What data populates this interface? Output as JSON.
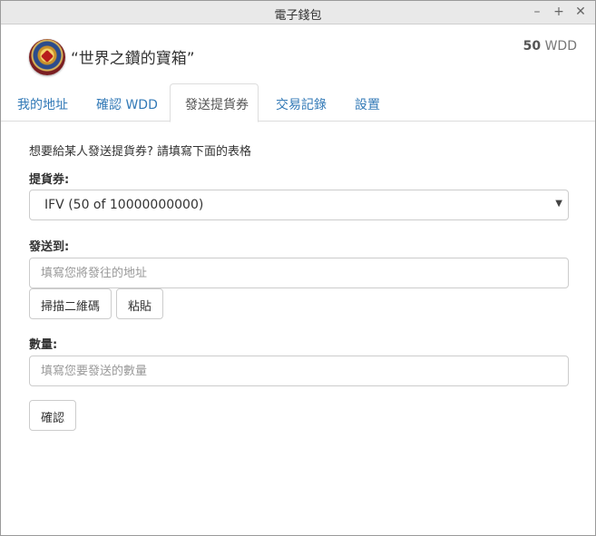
{
  "window": {
    "title": "電子錢包",
    "controls": {
      "minimize": "–",
      "maximize": "+",
      "close": "✕"
    }
  },
  "header": {
    "wallet_name": "“世界之鑽的寶箱”",
    "balance_amount": "50",
    "balance_unit": "WDD"
  },
  "tabs": [
    {
      "label": "我的地址",
      "active": false
    },
    {
      "label": "確認 WDD",
      "active": false
    },
    {
      "label": "發送提貨券",
      "active": true
    },
    {
      "label": "交易記錄",
      "active": false
    },
    {
      "label": "設置",
      "active": false
    }
  ],
  "form": {
    "intro": "想要給某人發送提貨券? 請填寫下面的表格",
    "voucher_label": "提貨券:",
    "voucher_selected": "IFV (50 of 10000000000)",
    "send_to_label": "發送到:",
    "address_placeholder": "填寫您將發往的地址",
    "scan_button": "掃描二維碼",
    "paste_button": "粘貼",
    "amount_label": "數量:",
    "amount_placeholder": "填寫您要發送的數量",
    "confirm_button": "確認"
  },
  "colors": {
    "link": "#337ab7",
    "border": "#cccccc",
    "titlebar": "#e9e9e9"
  }
}
